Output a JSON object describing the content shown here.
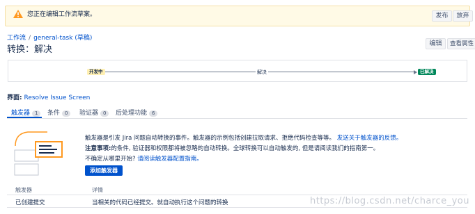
{
  "banner": {
    "message": "您正在编辑工作流草案。",
    "publish_label": "发布",
    "discard_label": "放弃"
  },
  "breadcrumb": {
    "root": "工作流",
    "separator": "/",
    "current": "general-task (草稿)"
  },
  "page": {
    "title": "转换：解决",
    "edit_label": "编辑",
    "view_props_label": "查看属性"
  },
  "diagram": {
    "from_status": "开发中",
    "transition": "解决",
    "to_status": "已解决"
  },
  "screen": {
    "label": "界面:",
    "link": "Resolve Issue Screen"
  },
  "tabs": [
    {
      "label": "触发器",
      "count": "1"
    },
    {
      "label": "条件",
      "count": "0"
    },
    {
      "label": "验证器",
      "count": "0"
    },
    {
      "label": "后处理功能",
      "count": "6"
    }
  ],
  "triggers_info": {
    "line1": "触发器是引发 Jira 问题自动转换的事件。触发器的示例包括创建拉取请求、拒绝代码检查等等。",
    "line1_link": "发送关于触发器的反馈。",
    "line2_bold": "注意事项:",
    "line2": "的条件, 验证器和权限都将被忽略的自动转换。全球转换可以自动触发的, 但是请阅读我们的指南第一。",
    "line3": "不确定从哪里开始?",
    "line3_link": "请阅读触发器配置指南。",
    "add_button": "添加触发器"
  },
  "table": {
    "headers": [
      "触发器",
      "详情"
    ],
    "rows": [
      [
        "已创建提交",
        "当相关的代码已经提交。就自动执行这个问题的转换"
      ]
    ]
  },
  "watermark": "https://blog.csdn.net/charce_you",
  "colors": {
    "banner_bg": "#fffae6",
    "link": "#0052cc",
    "from_status_bg": "#fff0b3",
    "to_status_bg": "#00875a",
    "illustration_accent": "#ff991f"
  }
}
